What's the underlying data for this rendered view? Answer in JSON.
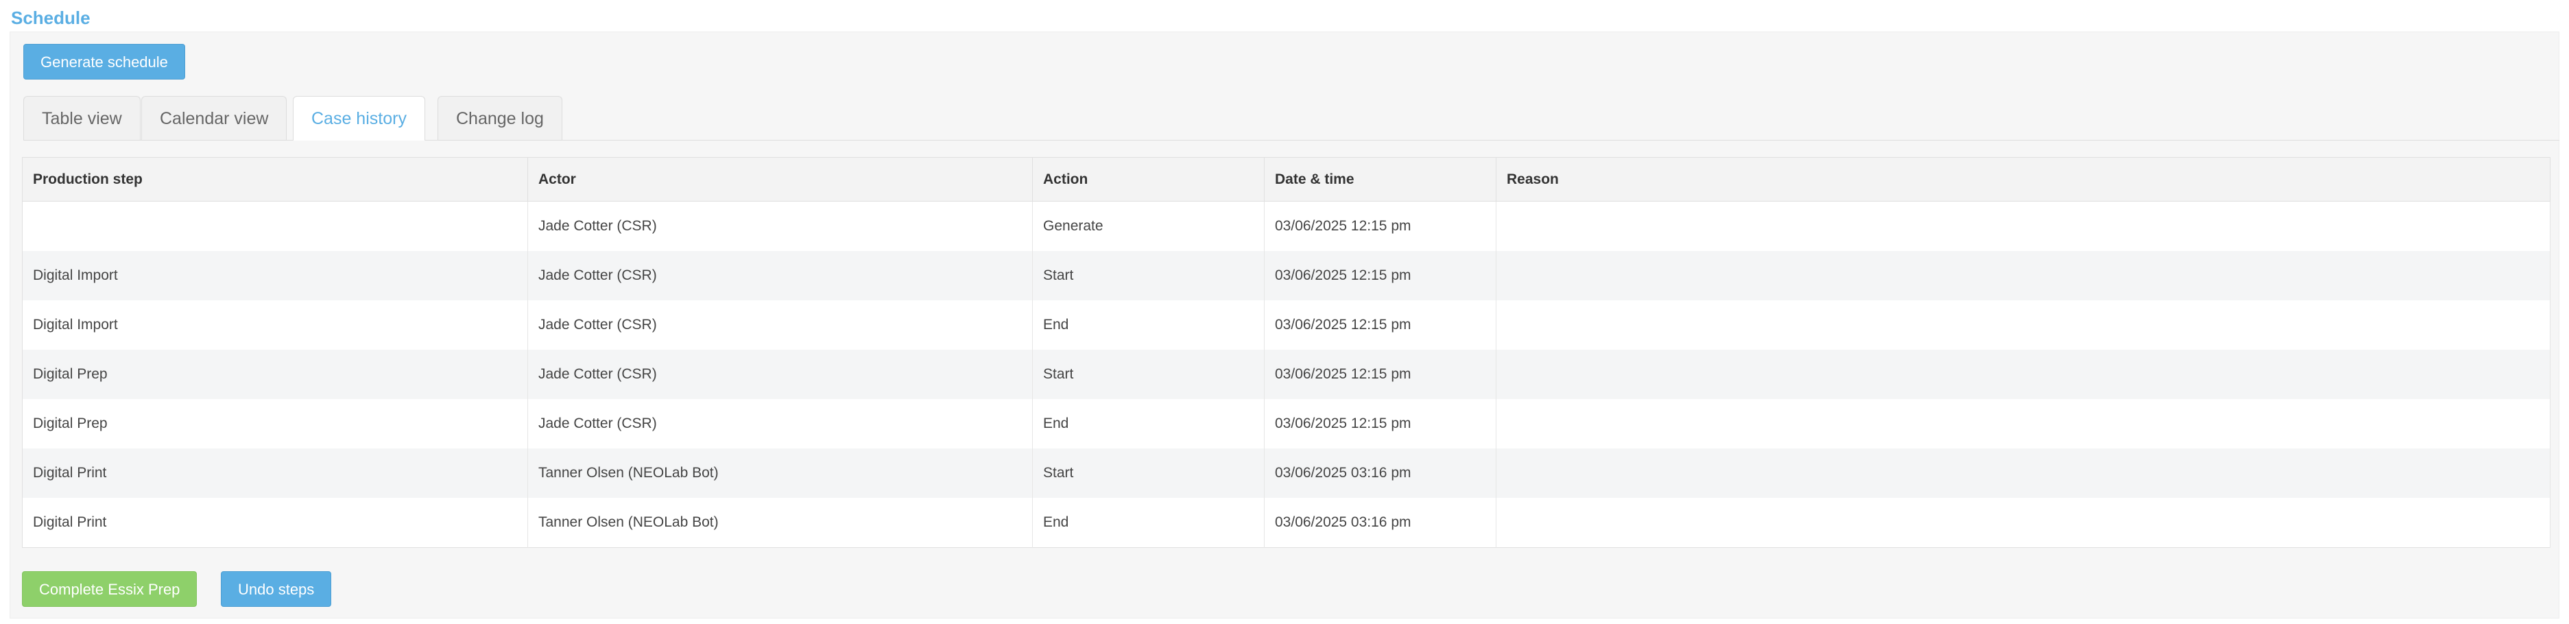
{
  "page": {
    "title": "Schedule"
  },
  "actions": {
    "generate_label": "Generate schedule"
  },
  "tabs": [
    {
      "label": "Table view",
      "active": false
    },
    {
      "label": "Calendar view",
      "active": false
    },
    {
      "label": "Case history",
      "active": true
    },
    {
      "label": "Change log",
      "active": false
    }
  ],
  "history_table": {
    "columns": [
      "Production step",
      "Actor",
      "Action",
      "Date & time",
      "Reason"
    ],
    "rows": [
      {
        "step": "",
        "actor": "Jade Cotter (CSR)",
        "action": "Generate",
        "datetime": "03/06/2025 12:15 pm",
        "reason": ""
      },
      {
        "step": "Digital Import",
        "actor": "Jade Cotter (CSR)",
        "action": "Start",
        "datetime": "03/06/2025 12:15 pm",
        "reason": ""
      },
      {
        "step": "Digital Import",
        "actor": "Jade Cotter (CSR)",
        "action": "End",
        "datetime": "03/06/2025 12:15 pm",
        "reason": ""
      },
      {
        "step": "Digital Prep",
        "actor": "Jade Cotter (CSR)",
        "action": "Start",
        "datetime": "03/06/2025 12:15 pm",
        "reason": ""
      },
      {
        "step": "Digital Prep",
        "actor": "Jade Cotter (CSR)",
        "action": "End",
        "datetime": "03/06/2025 12:15 pm",
        "reason": ""
      },
      {
        "step": "Digital Print",
        "actor": "Tanner Olsen (NEOLab Bot)",
        "action": "Start",
        "datetime": "03/06/2025 03:16 pm",
        "reason": ""
      },
      {
        "step": "Digital Print",
        "actor": "Tanner Olsen (NEOLab Bot)",
        "action": "End",
        "datetime": "03/06/2025 03:16 pm",
        "reason": ""
      }
    ]
  },
  "footer": {
    "complete_label": "Complete Essix Prep",
    "undo_label": "Undo steps"
  },
  "colors": {
    "accent": "#5aaee3",
    "success": "#8ed06a"
  }
}
